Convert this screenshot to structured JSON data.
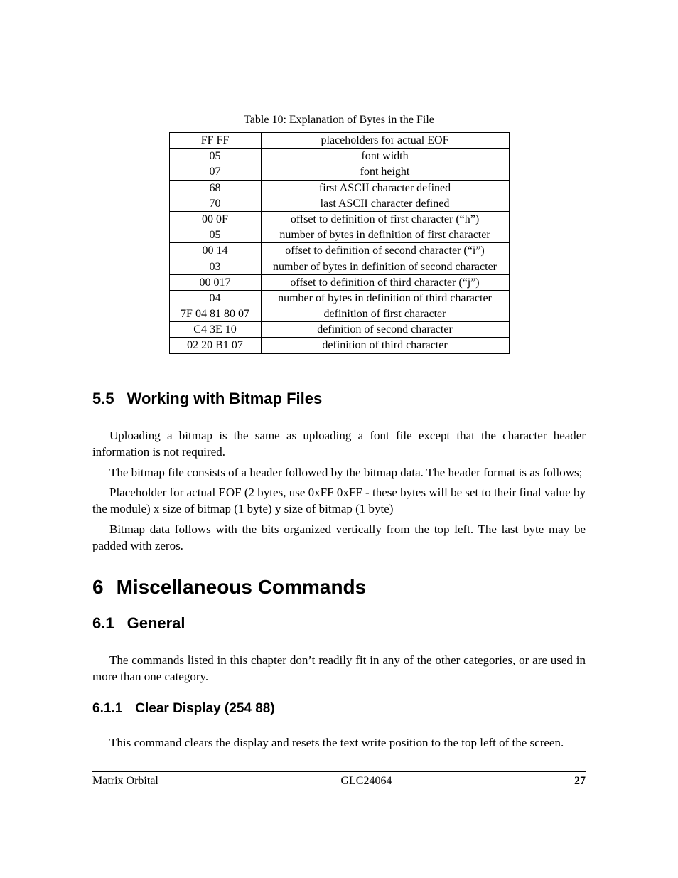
{
  "table": {
    "caption": "Table 10: Explanation of Bytes in the File",
    "rows": [
      {
        "a": "FF FF",
        "b": "placeholders for actual EOF"
      },
      {
        "a": "05",
        "b": "font width"
      },
      {
        "a": "07",
        "b": "font height"
      },
      {
        "a": "68",
        "b": "first ASCII character defined"
      },
      {
        "a": "70",
        "b": "last ASCII character defined"
      },
      {
        "a": "00 0F",
        "b": "offset to definition of first character (“h”)"
      },
      {
        "a": "05",
        "b": "number of bytes in definition of first character"
      },
      {
        "a": "00 14",
        "b": "offset to definition of second character (“i”)"
      },
      {
        "a": "03",
        "b": "number of bytes in definition of second character"
      },
      {
        "a": "00 017",
        "b": "offset to definition of third character (“j”)"
      },
      {
        "a": "04",
        "b": "number of bytes in definition of third character"
      },
      {
        "a": "7F 04 81 80 07",
        "b": "definition of first character"
      },
      {
        "a": "C4 3E 10",
        "b": "definition of second character"
      },
      {
        "a": "02 20 B1 07",
        "b": "definition of third character"
      }
    ]
  },
  "sec55": {
    "num": "5.5",
    "title": "Working with Bitmap Files",
    "p1": "Uploading a bitmap is the same as uploading a font file except that the character header information is not required.",
    "p2": "The bitmap file consists of a header followed by the bitmap data. The header format is as follows;",
    "p3": "Placeholder for actual EOF (2 bytes, use 0xFF 0xFF - these bytes will be set to their final value by the module) x size of bitmap (1 byte) y size of bitmap (1 byte)",
    "p4": "Bitmap data follows with the bits organized vertically from the top left. The last byte may be padded with zeros."
  },
  "chap6": {
    "num": "6",
    "title": "Miscellaneous Commands"
  },
  "sec61": {
    "num": "6.1",
    "title": "General",
    "p1": "The commands listed in this chapter don’t readily fit in any of the other categories, or are used in more than one category."
  },
  "sec611": {
    "num": "6.1.1",
    "title": "Clear Display (254 88)",
    "p1": "This command clears the display and resets the text write position to the top left of the screen."
  },
  "footer": {
    "left": "Matrix Orbital",
    "center": "GLC24064",
    "page": "27"
  }
}
